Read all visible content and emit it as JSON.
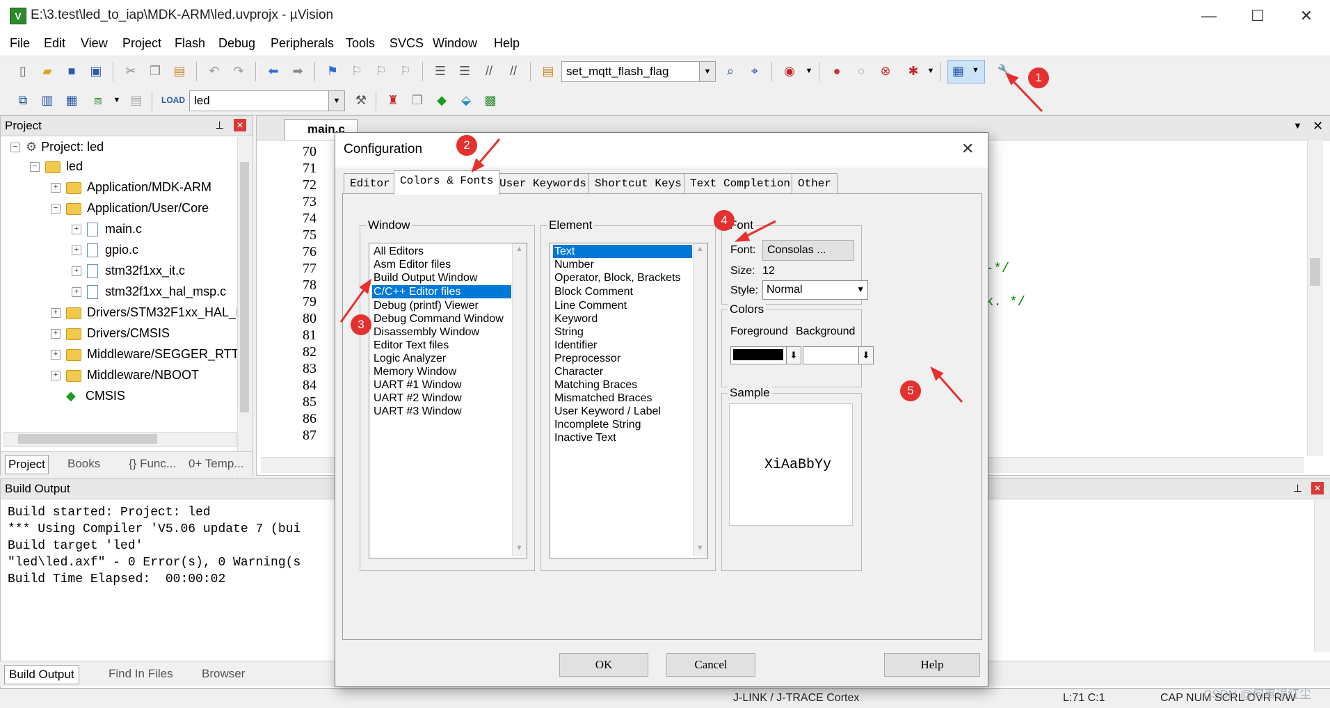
{
  "window": {
    "title": "E:\\3.test\\led_to_iap\\MDK-ARM\\led.uvprojx - µVision",
    "minimize": "—",
    "maximize": "☐",
    "close": "✕"
  },
  "menu": [
    "File",
    "Edit",
    "View",
    "Project",
    "Flash",
    "Debug",
    "Peripherals",
    "Tools",
    "SVCS",
    "Window",
    "Help"
  ],
  "toolbar": {
    "find_combo": "set_mqtt_flash_flag",
    "target_combo": "led"
  },
  "project": {
    "header": "Project",
    "root": "Project: led",
    "target": "led",
    "groups": [
      {
        "label": "Application/MDK-ARM",
        "expanded": false
      },
      {
        "label": "Application/User/Core",
        "expanded": true
      },
      {
        "label": "Drivers/STM32F1xx_HAL_I",
        "expanded": false
      },
      {
        "label": "Drivers/CMSIS",
        "expanded": false
      },
      {
        "label": "Middleware/SEGGER_RTT",
        "expanded": false
      },
      {
        "label": "Middleware/NBOOT",
        "expanded": false
      }
    ],
    "files": [
      "main.c",
      "gpio.c",
      "stm32f1xx_it.c",
      "stm32f1xx_hal_msp.c"
    ],
    "cmsis": "CMSIS",
    "tabs": [
      "Project",
      "Books",
      "{} Func...",
      "0+ Temp..."
    ]
  },
  "editor": {
    "tab": "main.c",
    "line_numbers": [
      "70",
      "71",
      "72",
      "73",
      "74",
      "75",
      "76",
      "77",
      "78",
      "79",
      "80",
      "81",
      "82",
      "83",
      "84",
      "85",
      "86",
      "87"
    ],
    "fragment_1": "-*/",
    "fragment_2": "k. */"
  },
  "build_output": {
    "header": "Build Output",
    "lines": [
      "Build started: Project: led",
      "*** Using Compiler 'V5.06 update 7 (bui",
      "Build target 'led'",
      "\"led\\led.axf\" - 0 Error(s), 0 Warning(s",
      "Build Time Elapsed:  00:00:02"
    ],
    "tabs": [
      "Build Output",
      "Find In Files",
      "Browser"
    ]
  },
  "status": {
    "debugger": "J-LINK / J-TRACE Cortex",
    "position": "L:71 C:1",
    "flags": "CAP  NUM  SCRL  OVR  R/W"
  },
  "dialog": {
    "title": "Configuration",
    "tabs": [
      "Editor",
      "Colors & Fonts",
      "User Keywords",
      "Shortcut Keys",
      "Text Completion",
      "Other"
    ],
    "window_group": "Window",
    "window_items": [
      "All Editors",
      "Asm Editor files",
      "Build Output Window",
      "C/C++ Editor files",
      "Debug (printf) Viewer",
      "Debug Command Window",
      "Disassembly Window",
      "Editor Text files",
      "Logic Analyzer",
      "Memory Window",
      "UART #1 Window",
      "UART #2 Window",
      "UART #3 Window"
    ],
    "window_selected": 3,
    "element_group": "Element",
    "element_items": [
      "Text",
      "Number",
      "Operator, Block, Brackets",
      "Block Comment",
      "Line Comment",
      "Keyword",
      "String",
      "Identifier",
      "Preprocessor",
      "Character",
      "Matching Braces",
      "Mismatched Braces",
      "User Keyword / Label",
      "Incomplete String",
      "Inactive Text"
    ],
    "element_selected": 0,
    "font_group": "Font",
    "font_label": "Font:",
    "font_value": "Consolas ...",
    "size_label": "Size:",
    "size_value": "12",
    "style_label": "Style:",
    "style_value": "Normal",
    "colors_group": "Colors",
    "foreground_label": "Foreground",
    "background_label": "Background",
    "foreground_color": "#000000",
    "background_color": "#ffffff",
    "sample_group": "Sample",
    "sample_text": "XiAaBbYy",
    "ok": "OK",
    "cancel": "Cancel",
    "help": "Help"
  },
  "markers": [
    "1",
    "2",
    "3",
    "4",
    "5"
  ],
  "watermark": "CSDN @何事误红尘",
  "colors": {
    "selection": "#0078d7",
    "marker": "#e53030",
    "comment_green": "#008000"
  }
}
